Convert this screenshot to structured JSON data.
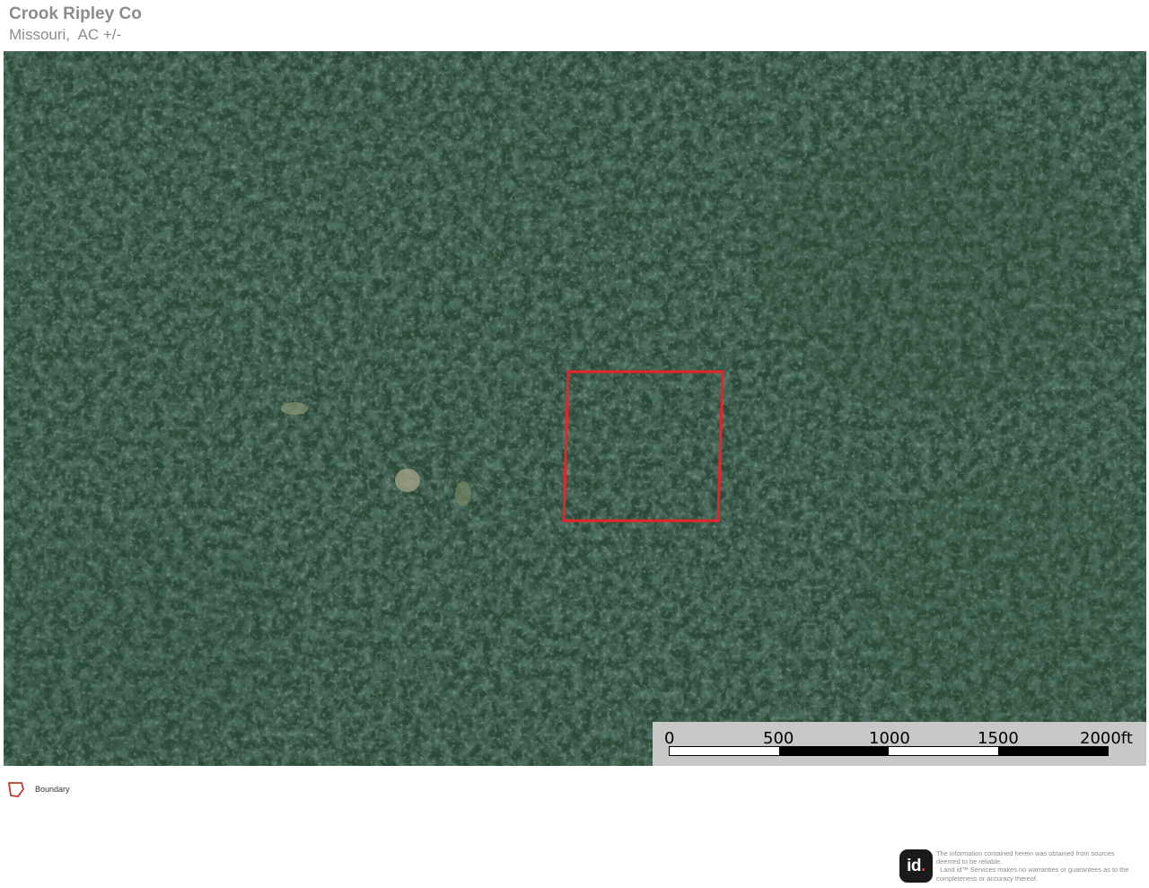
{
  "header": {
    "title": "Crook Ripley Co",
    "subtitle": "Missouri,  AC +/-"
  },
  "map": {
    "imagery": "aerial-forest-canopy",
    "boundary_color": "#e8232a",
    "scale_bar": {
      "labels": [
        "0",
        "500",
        "1000",
        "1500",
        "2000ft"
      ],
      "units": "ft"
    }
  },
  "legend": {
    "items": [
      {
        "label": "Boundary",
        "icon": "boundary-polygon-icon",
        "color": "#c0392b"
      }
    ]
  },
  "footer": {
    "logo_text": "id",
    "disclaimer_lines": [
      "The information contained herein was obtained from  sources",
      "deemed to be reliable.",
      "  Land id™ Services makes no warranties or guarantees as to the",
      "completeness or accuracy thereof."
    ]
  }
}
